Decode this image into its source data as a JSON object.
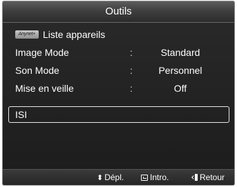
{
  "title": "Outils",
  "menu": {
    "anynet_badge": "Anynet+",
    "items": [
      {
        "label": "Liste appareils",
        "colon": "",
        "value": ""
      },
      {
        "label": "Image Mode",
        "colon": ":",
        "value": "Standard"
      },
      {
        "label": "Son Mode",
        "colon": ":",
        "value": "Personnel"
      },
      {
        "label": "Mise en veille",
        "colon": ":",
        "value": "Off"
      },
      {
        "label": "ISI",
        "colon": "",
        "value": ""
      }
    ]
  },
  "footer": {
    "move_icon": "up-down-arrows-icon",
    "move_label": "Dépl.",
    "enter_icon": "enter-icon",
    "enter_label": "Intro.",
    "return_icon": "return-icon",
    "return_label": "Retour"
  }
}
